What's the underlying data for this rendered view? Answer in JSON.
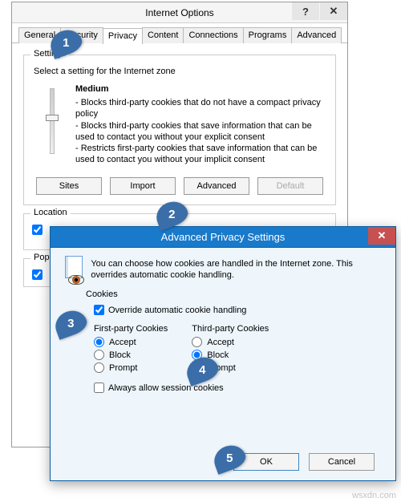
{
  "main": {
    "title": "Internet Options",
    "help": "?",
    "close": "✕",
    "tabs": [
      "General",
      "Security",
      "Privacy",
      "Content",
      "Connections",
      "Programs",
      "Advanced"
    ],
    "active_tab": 2,
    "settings_label": "Settings",
    "zone_desc": "Select a setting for the Internet zone",
    "level": "Medium",
    "bullet1": "- Blocks third-party cookies that do not have a compact privacy policy",
    "bullet2": "- Blocks third-party cookies that save information that can be used to contact you without your explicit consent",
    "bullet3": "- Restricts first-party cookies that save information that can be used to contact you without your implicit consent",
    "btn_sites": "Sites",
    "btn_import": "Import",
    "btn_advanced": "Advanced",
    "btn_default": "Default",
    "location_label": "Location",
    "popup_label": "Pop-up Blocker"
  },
  "adv": {
    "title": "Advanced Privacy Settings",
    "close": "✕",
    "intro": "You can choose how cookies are handled in the Internet zone. This overrides automatic cookie handling.",
    "cookies_label": "Cookies",
    "override": "Override automatic cookie handling",
    "col1_title": "First-party Cookies",
    "col2_title": "Third-party Cookies",
    "accept": "Accept",
    "block": "Block",
    "prompt": "Prompt",
    "session": "Always allow session cookies",
    "ok": "OK",
    "cancel": "Cancel"
  },
  "markers": {
    "n1": "1",
    "n2": "2",
    "n3": "3",
    "n4": "4",
    "n5": "5"
  },
  "watermark": "wsxdn.com"
}
